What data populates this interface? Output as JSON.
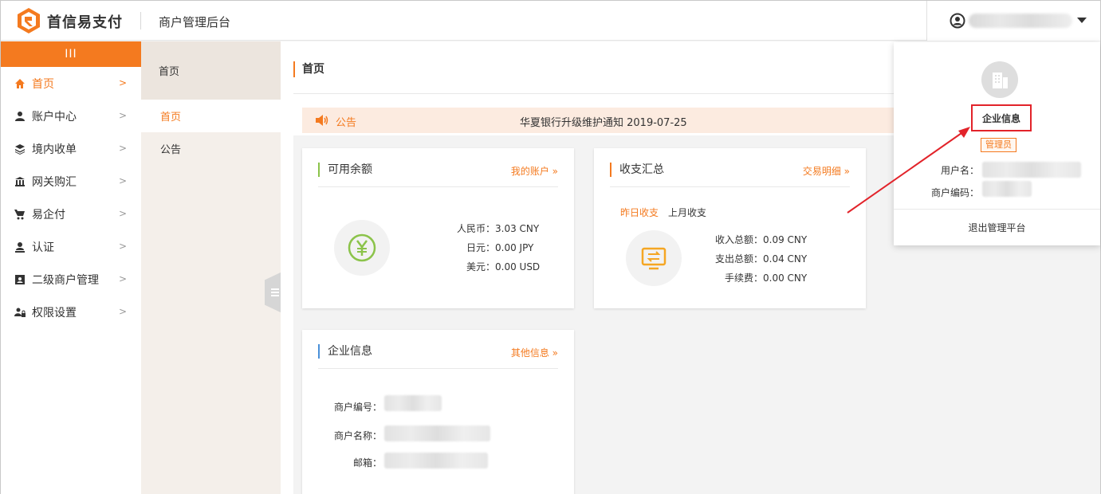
{
  "header": {
    "brand": "首信易支付",
    "title": "商户管理后台"
  },
  "sidebar": {
    "toggle_label": "III",
    "items": [
      {
        "label": "首页",
        "icon": "home-icon",
        "active": true
      },
      {
        "label": "账户中心",
        "icon": "user-icon"
      },
      {
        "label": "境内收单",
        "icon": "layers-icon"
      },
      {
        "label": "网关购汇",
        "icon": "bank-icon"
      },
      {
        "label": "易企付",
        "icon": "cart-icon"
      },
      {
        "label": "认证",
        "icon": "certify-icon"
      },
      {
        "label": "二级商户管理",
        "icon": "id-card-icon"
      },
      {
        "label": "权限设置",
        "icon": "lock-icon"
      }
    ]
  },
  "subbar": {
    "head": "首页",
    "items": [
      {
        "label": "首页",
        "active": true
      },
      {
        "label": "公告"
      }
    ]
  },
  "main": {
    "page_title": "首页",
    "notice": {
      "label": "公告",
      "text": "华夏银行升级维护通知 2019-07-25"
    },
    "balance_card": {
      "title": "可用余额",
      "link": "我的账户 »",
      "rows": [
        {
          "k": "人民币：",
          "v": "3.03 CNY"
        },
        {
          "k": "日元：",
          "v": "0.00 JPY"
        },
        {
          "k": "美元：",
          "v": "0.00 USD"
        }
      ]
    },
    "summary_card": {
      "title": "收支汇总",
      "link": "交易明细 »",
      "tab_yesterday": "昨日收支",
      "tab_last_month": "上月收支",
      "rows": [
        {
          "k": "收入总额：",
          "v": "0.09 CNY"
        },
        {
          "k": "支出总额：",
          "v": "0.04 CNY"
        },
        {
          "k": "手续费：",
          "v": "0.00 CNY"
        }
      ]
    },
    "company_card": {
      "title": "企业信息",
      "link": "其他信息 »",
      "rows": [
        {
          "k": "商户编号："
        },
        {
          "k": "商户名称："
        },
        {
          "k": "邮箱："
        }
      ]
    }
  },
  "dropdown": {
    "company_label": "企业信息",
    "role": "管理员",
    "username_label": "用户名：",
    "merchant_code_label": "商户编码：",
    "logout": "退出管理平台"
  },
  "colors": {
    "accent": "#f47a1f",
    "highlight_border": "#e2232a",
    "arrow": "#e2232a"
  }
}
